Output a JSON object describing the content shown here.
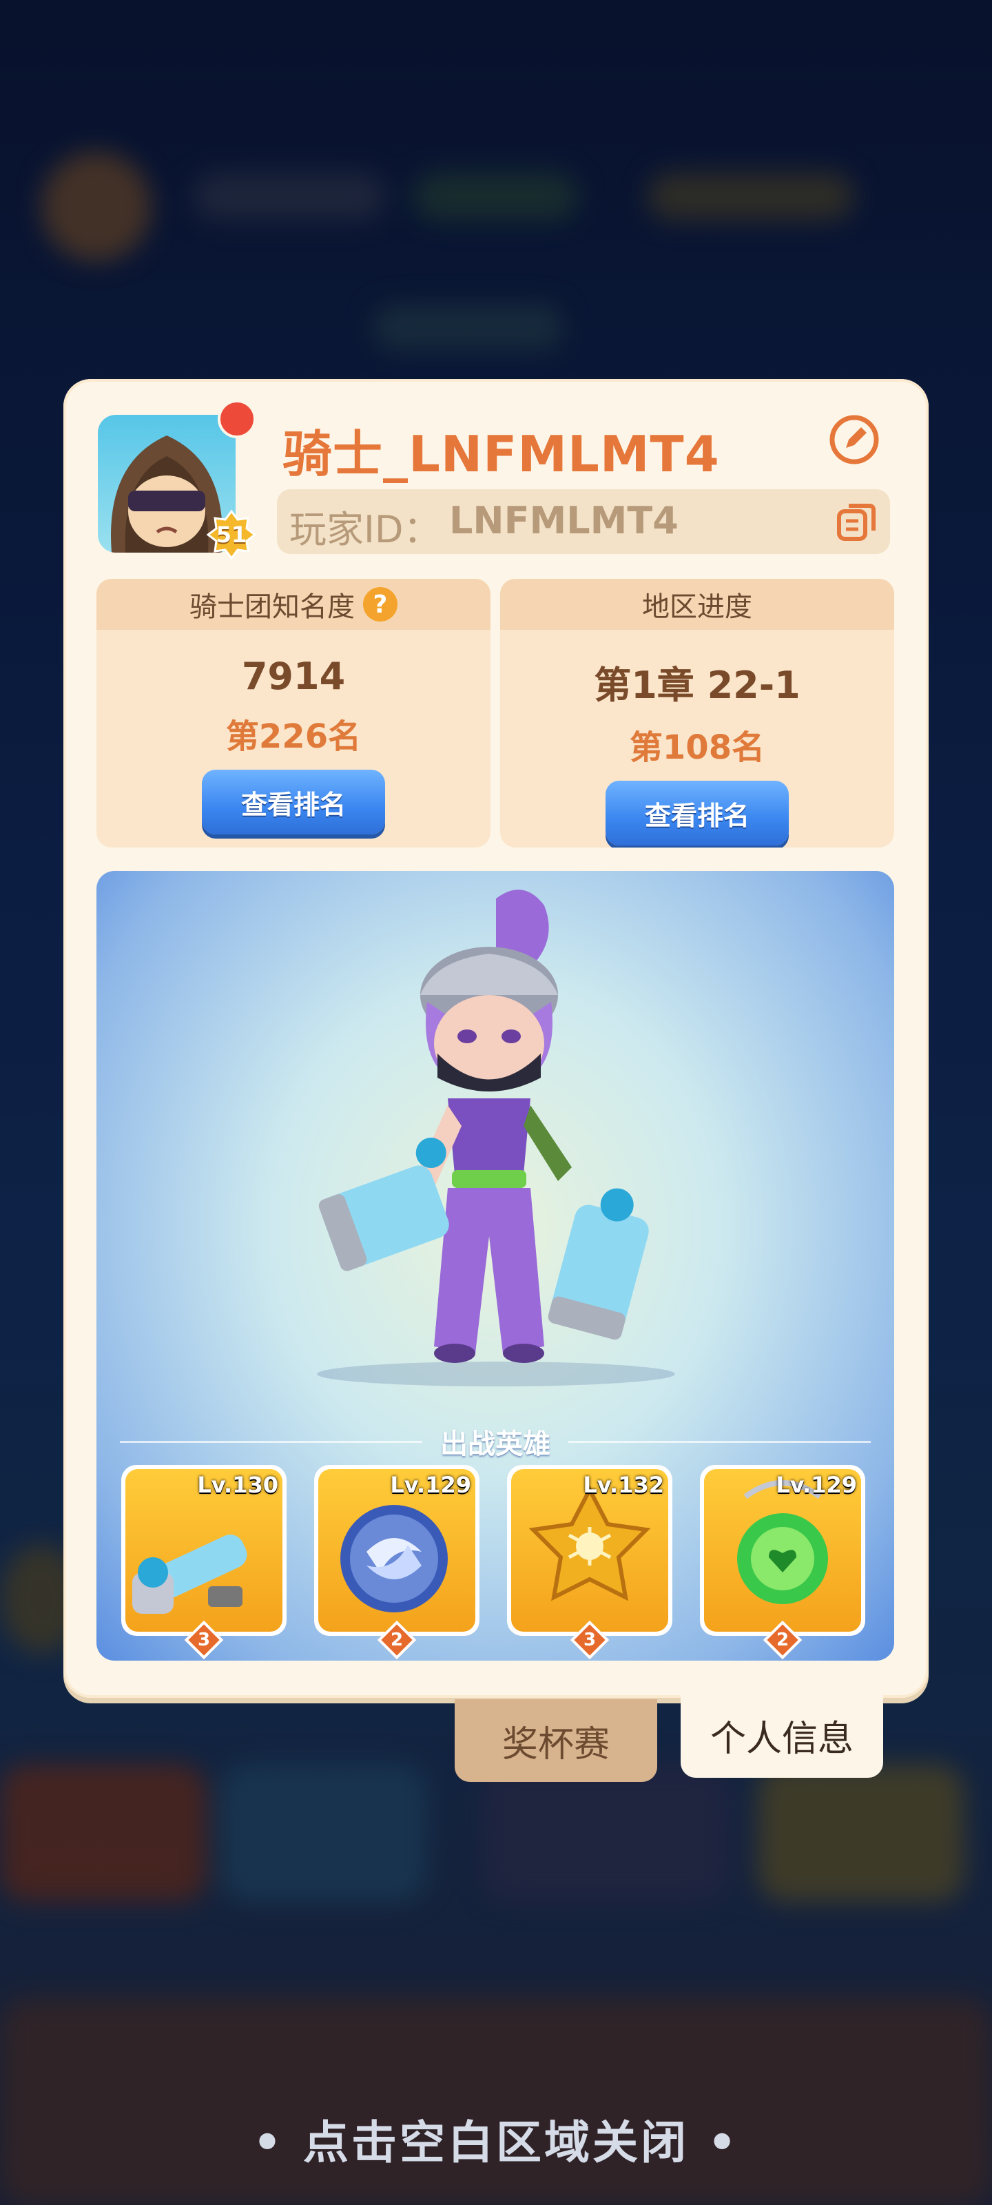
{
  "profile": {
    "name": "骑士_LNFMLMT4",
    "level": "51",
    "player_id_label": "玩家ID：",
    "player_id": "LNFMLMT4"
  },
  "stats": {
    "fame": {
      "title": "骑士团知名度",
      "value": "7914",
      "rank": "第226名",
      "button": "查看排名"
    },
    "region": {
      "title": "地区进度",
      "value": "第1章 22-1",
      "rank": "第108名",
      "button": "查看排名"
    }
  },
  "heroes": {
    "section_title": "出战英雄",
    "equipment": [
      {
        "level": "Lv.130",
        "stars": "3",
        "icon": "blaster-weapon-icon"
      },
      {
        "level": "Lv.129",
        "stars": "2",
        "icon": "swirl-orb-icon"
      },
      {
        "level": "Lv.132",
        "stars": "3",
        "icon": "spider-star-badge-icon"
      },
      {
        "level": "Lv.129",
        "stars": "2",
        "icon": "green-heart-amulet-icon"
      }
    ]
  },
  "tabs": {
    "trophy": "奖杯赛",
    "profile": "个人信息"
  },
  "footer": {
    "close_hint": "• 点击空白区域关闭 •"
  },
  "colors": {
    "panel": "#fdf6e8",
    "name": "#e6773a",
    "button": "#3a86f0",
    "equip_bg": "#f4a21c"
  }
}
